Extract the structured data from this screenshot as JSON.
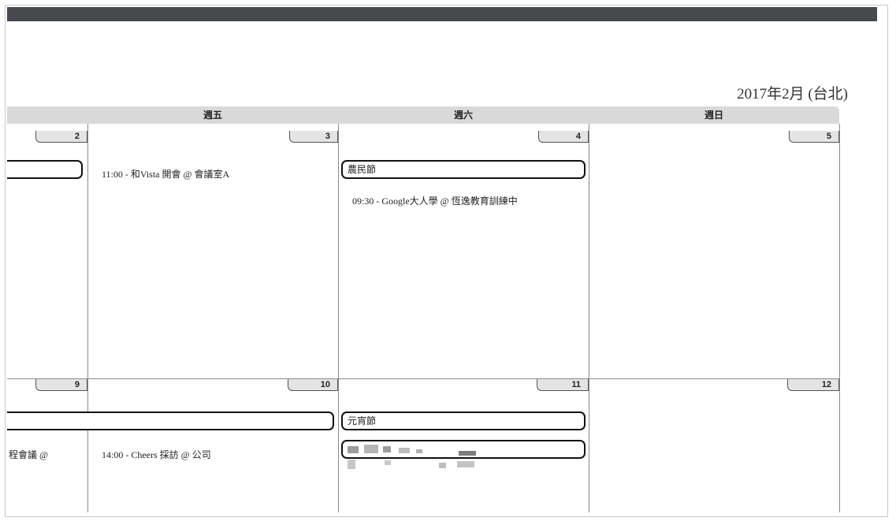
{
  "calendar": {
    "month_title": "2017年2月 (台北)",
    "weekdays": [
      {
        "label": "週五"
      },
      {
        "label": "週六"
      },
      {
        "label": "週日"
      }
    ],
    "day_numbers": {
      "d2": "2",
      "d3": "3",
      "d4": "4",
      "d5": "5",
      "d9": "9",
      "d10": "10",
      "d11": "11",
      "d12": "12"
    },
    "all_day_events": {
      "holiday_4": "農民節",
      "holiday_11": "元宵節"
    },
    "timed_events": {
      "feb3": "11:00 - 和Vista 開會 @ 會議室A",
      "feb4": "09:30 - Google大人學 @ 恆逸教育訓練中",
      "feb9_partial": "程會議 @",
      "feb10": "14:00 - Cheers 採訪 @ 公司"
    }
  }
}
